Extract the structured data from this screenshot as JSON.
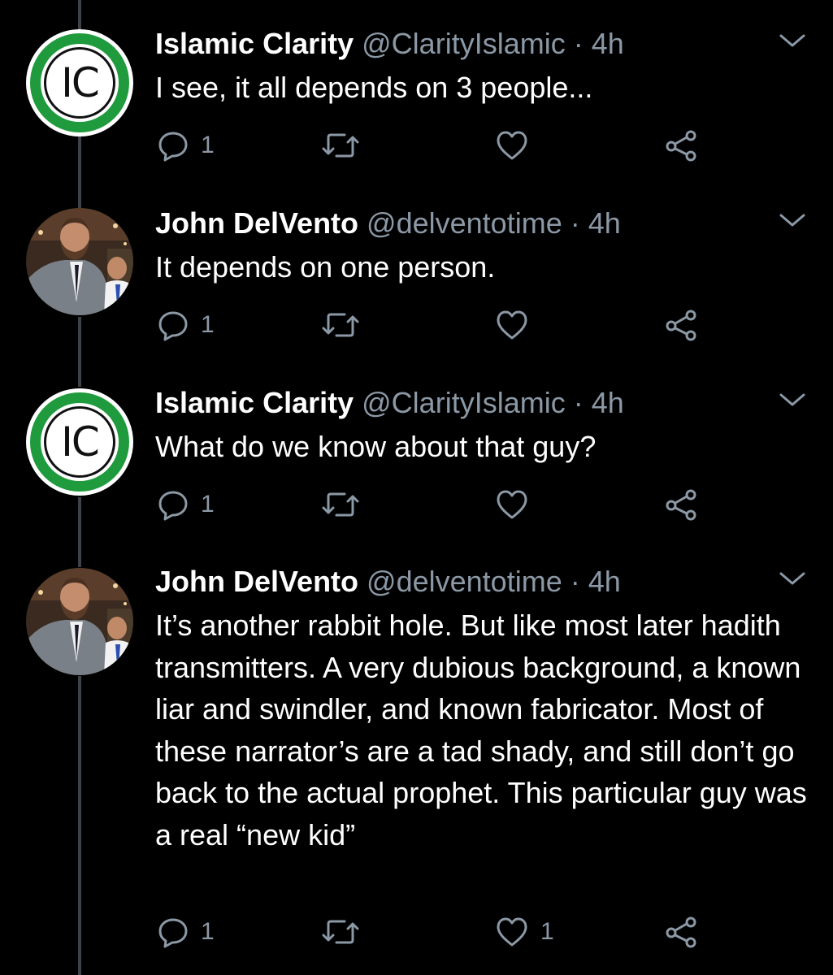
{
  "colors": {
    "background": "#000000",
    "text": "#ffffff",
    "muted": "#8b98a5",
    "thread_line": "#3d4248",
    "ic_green": "#1f9a3c"
  },
  "tweets": [
    {
      "name": "Islamic Clarity",
      "handle": "@ClarityIslamic",
      "time": "4h",
      "text": "I see, it all depends on 3 people...",
      "replies": "1",
      "retweets": "",
      "likes": "",
      "avatar": "ic-logo",
      "avatar_text": "IC"
    },
    {
      "name": "John DelVento",
      "handle": "@delventotime",
      "time": "4h",
      "text": "It depends on one person.",
      "replies": "1",
      "retweets": "",
      "likes": "",
      "avatar": "profile-photo"
    },
    {
      "name": "Islamic Clarity",
      "handle": "@ClarityIslamic",
      "time": "4h",
      "text": "What do we know about that guy?",
      "replies": "1",
      "retweets": "",
      "likes": "",
      "avatar": "ic-logo",
      "avatar_text": "IC"
    },
    {
      "name": "John DelVento",
      "handle": "@delventotime",
      "time": "4h",
      "text": "It’s another rabbit hole. But like most later hadith transmitters. A very dubious background, a known liar and swindler, and known fabricator. Most of these narrator’s are a tad shady, and still don’t go back to the actual prophet.  This particular guy was a real “new kid”",
      "replies": "1",
      "retweets": "",
      "likes": "1",
      "avatar": "profile-photo"
    }
  ],
  "icons": {
    "reply": "reply-bubble-icon",
    "retweet": "retweet-icon",
    "like": "heart-icon",
    "share": "share-icon",
    "more": "chevron-down-icon"
  },
  "separator": " · "
}
